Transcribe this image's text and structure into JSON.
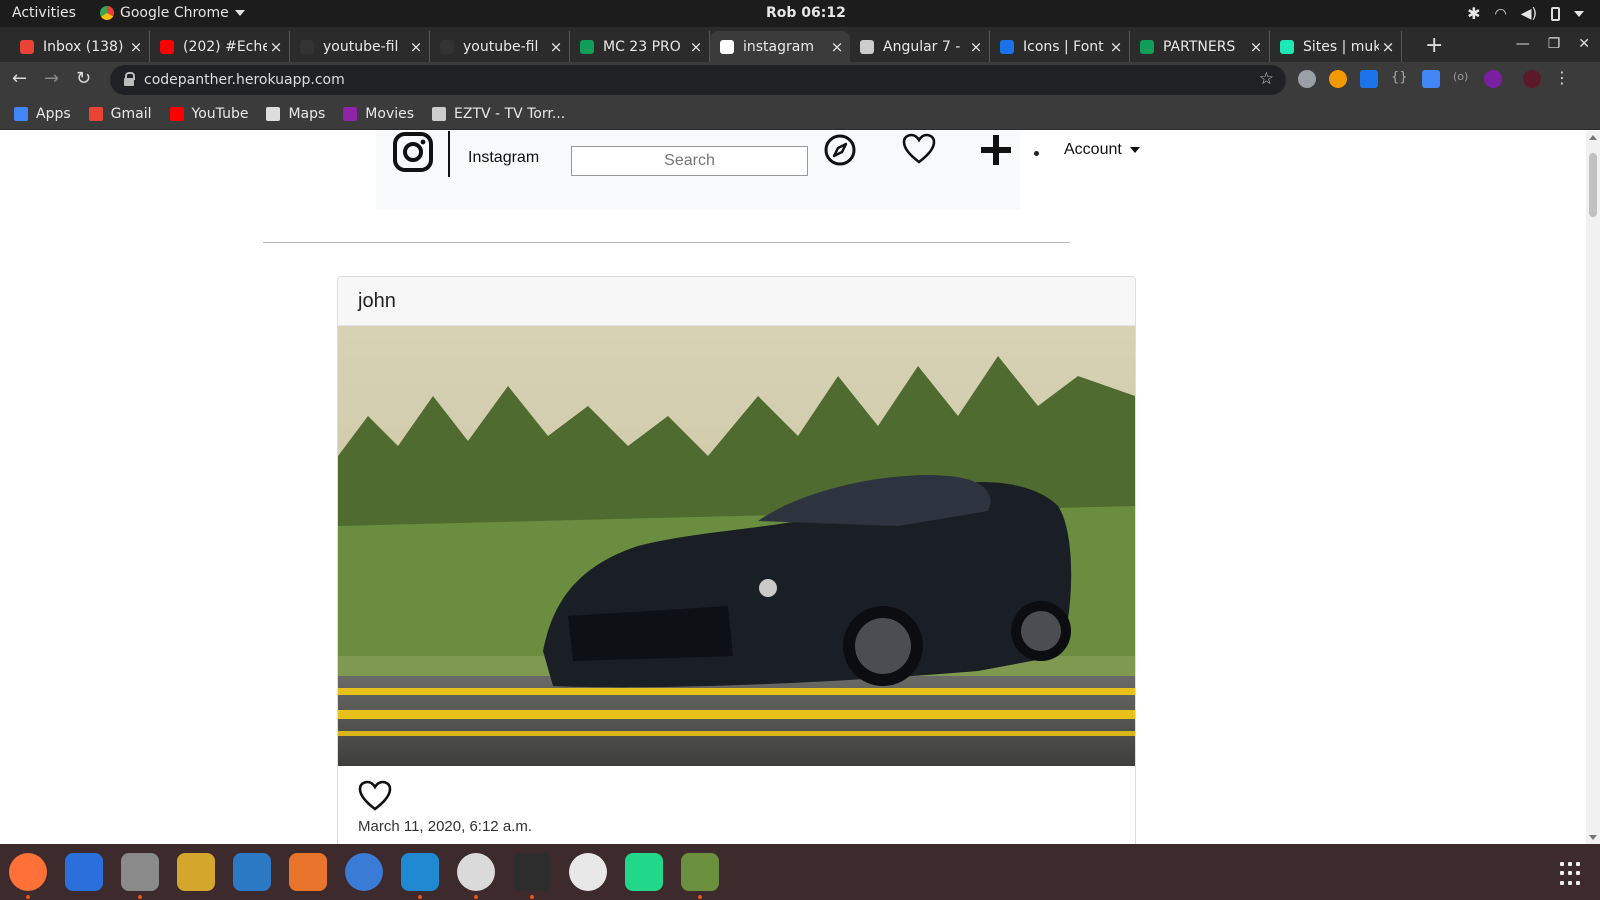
{
  "topbar": {
    "activities": "Activities",
    "app_name": "Google Chrome",
    "clock": "Rob 06:12"
  },
  "tabs": [
    {
      "label": "Inbox (138)",
      "color": "#ea4335"
    },
    {
      "label": "(202) #Eche",
      "color": "#ff0000"
    },
    {
      "label": "youtube-fil",
      "color": "#333333"
    },
    {
      "label": "youtube-fil",
      "color": "#333333"
    },
    {
      "label": "MC 23 PRO",
      "color": "#0f9d58"
    },
    {
      "label": "instagram",
      "color": "#ffffff"
    },
    {
      "label": "Angular 7 -",
      "color": "#cccccc"
    },
    {
      "label": "Icons | Font",
      "color": "#1a73e8"
    },
    {
      "label": "PARTNERS",
      "color": "#0f9d58"
    },
    {
      "label": "Sites | muk",
      "color": "#1de9b6"
    }
  ],
  "address_bar": {
    "url": "codepanther.herokuapp.com"
  },
  "bookmarks": [
    {
      "label": "Apps",
      "color": "#4285f4"
    },
    {
      "label": "Gmail",
      "color": "#ea4335"
    },
    {
      "label": "YouTube",
      "color": "#ff0000"
    },
    {
      "label": "Maps",
      "color": "#dddddd"
    },
    {
      "label": "Movies",
      "color": "#8e24aa"
    },
    {
      "label": "EZTV - TV Torr...",
      "color": "#cccccc"
    }
  ],
  "site": {
    "brand": "Instagram",
    "search_placeholder": "Search",
    "account_label": "Account"
  },
  "post": {
    "username": "john",
    "date": "March 11, 2020, 6:12 a.m."
  },
  "dock": {
    "apps": [
      "firefox",
      "thunderbird",
      "files",
      "rhythmbox",
      "libreoffice-writer",
      "software-center",
      "help",
      "vscode",
      "chrome",
      "terminal",
      "slack",
      "pycharm",
      "text-editor"
    ]
  }
}
